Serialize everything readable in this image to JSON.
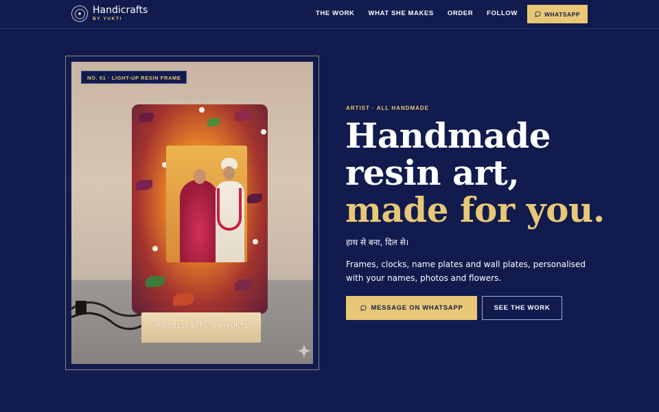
{
  "brand": {
    "name": "Handicrafts",
    "sub": "BY YUKTI"
  },
  "nav": {
    "items": [
      "THE WORK",
      "WHAT SHE MAKES",
      "ORDER",
      "FOLLOW"
    ],
    "whatsapp_label": "WHATSAPP"
  },
  "showcase": {
    "badge": "NO. 01 · LIGHT-UP RESIN FRAME",
    "engraving": "@handicrafts_by_yukti"
  },
  "hero": {
    "eyebrow": "ARTIST · ALL HANDMADE",
    "headline_line1": "Handmade",
    "headline_line2": "resin art,",
    "headline_line3": "made for you.",
    "tagline_hindi": "हाथ से बना, दिल से।",
    "description": "Frames, clocks, name plates and wall plates, personalised with your names, photos and flowers.",
    "primary_cta": "MESSAGE ON WHATSAPP",
    "secondary_cta": "SEE THE WORK"
  },
  "colors": {
    "background": "#111b4d",
    "accent_gold": "#e8c877",
    "text": "#ffffff"
  },
  "icons": {
    "brand": "concentric-circle-logo-icon",
    "chat": "chat-bubble-icon",
    "sparkle": "sparkle-icon"
  }
}
